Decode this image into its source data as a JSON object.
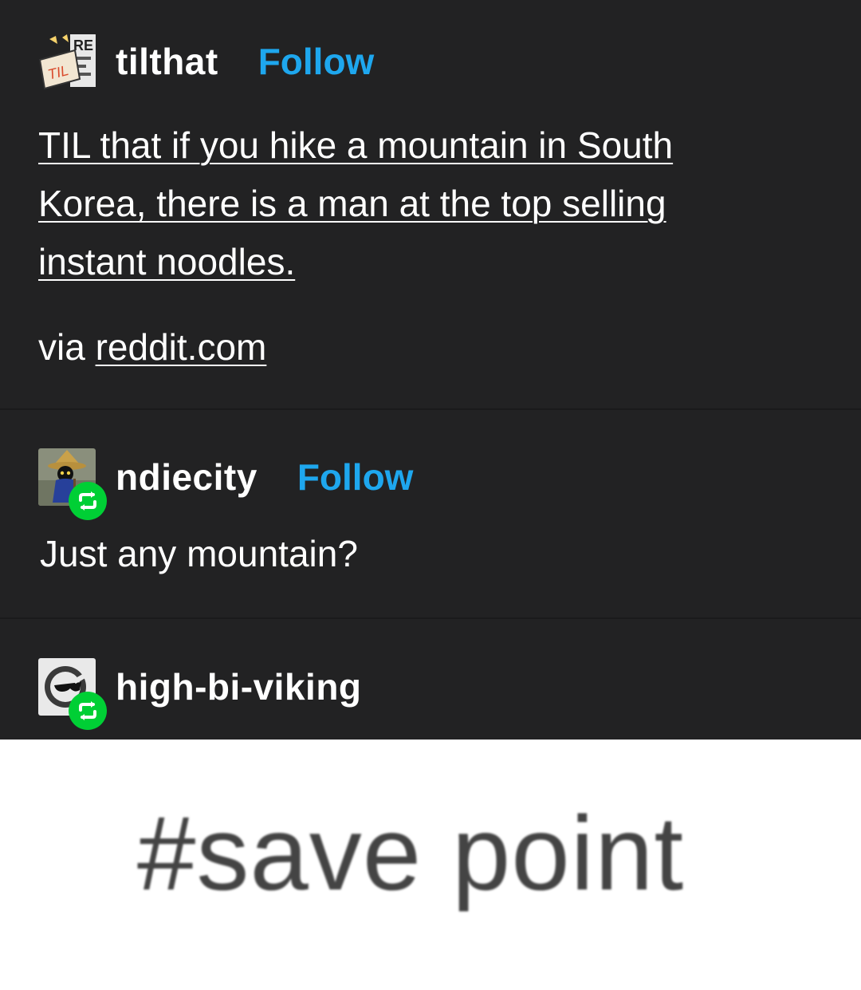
{
  "posts": [
    {
      "username": "tilthat",
      "follow_label": "Follow",
      "avatar_icon": "til-logo-avatar",
      "body_link_lines": [
        "TIL that if you hike a mountain in South",
        "Korea, there is a man at the top selling",
        "instant noodles."
      ],
      "via_prefix": "via",
      "via_link": "reddit.com"
    },
    {
      "username": "ndiecity",
      "follow_label": "Follow",
      "avatar_icon": "black-mage-avatar",
      "reblog_icon": "reblog-icon",
      "body": "Just any mountain?"
    },
    {
      "username": "high-bi-viking",
      "avatar_icon": "sunglasses-avatar",
      "reblog_icon": "reblog-icon"
    }
  ],
  "tag_image": {
    "text": "#save point"
  },
  "colors": {
    "background": "#222223",
    "follow_blue": "#1ea7ee",
    "reblog_green": "#00cf35",
    "tag_panel_bg": "#ffffff"
  }
}
